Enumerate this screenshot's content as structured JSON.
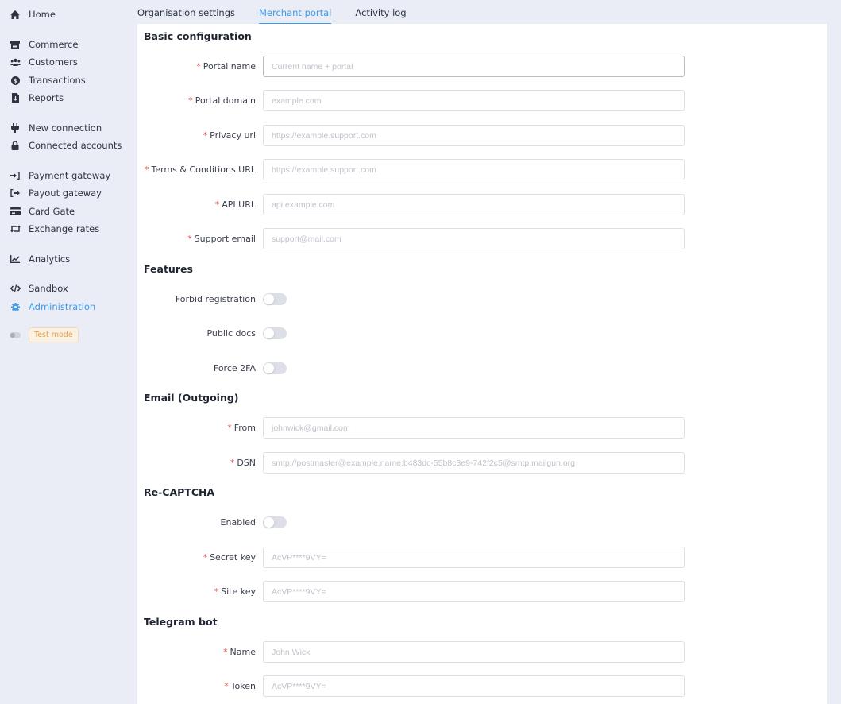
{
  "sidebar": {
    "items": [
      {
        "label": "Home",
        "icon": "home-icon"
      },
      {
        "label": "Commerce",
        "icon": "store-icon"
      },
      {
        "label": "Customers",
        "icon": "users-icon"
      },
      {
        "label": "Transactions",
        "icon": "dollar-circle-icon"
      },
      {
        "label": "Reports",
        "icon": "file-download-icon"
      },
      {
        "label": "New connection",
        "icon": "plug-icon"
      },
      {
        "label": "Connected accounts",
        "icon": "lock-icon"
      },
      {
        "label": "Payment gateway",
        "icon": "sign-in-icon"
      },
      {
        "label": "Payout gateway",
        "icon": "sign-out-icon"
      },
      {
        "label": "Card Gate",
        "icon": "credit-card-icon"
      },
      {
        "label": "Exchange rates",
        "icon": "retweet-icon"
      },
      {
        "label": "Analytics",
        "icon": "chart-line-icon"
      },
      {
        "label": "Sandbox",
        "icon": "code-icon"
      },
      {
        "label": "Administration",
        "icon": "gear-icon",
        "active": true
      }
    ],
    "test_mode_label": "Test mode"
  },
  "tabs": [
    {
      "label": "Organisation settings"
    },
    {
      "label": "Merchant portal",
      "active": true
    },
    {
      "label": "Activity log"
    }
  ],
  "sections": {
    "basic": {
      "title": "Basic configuration",
      "fields": [
        {
          "label": "Portal name",
          "placeholder": "Current name + portal",
          "required": true
        },
        {
          "label": "Portal domain",
          "placeholder": "example.com",
          "required": true
        },
        {
          "label": "Privacy url",
          "placeholder": "https://example.support.com",
          "required": true
        },
        {
          "label": "Terms & Conditions URL",
          "placeholder": "https://example.support.com",
          "required": true
        },
        {
          "label": "API URL",
          "placeholder": "api.example.com",
          "required": true
        },
        {
          "label": "Support email",
          "placeholder": "support@mail.com",
          "required": true
        }
      ]
    },
    "features": {
      "title": "Features",
      "toggles": [
        {
          "label": "Forbid registration",
          "on": false
        },
        {
          "label": "Public docs",
          "on": false
        },
        {
          "label": "Force 2FA",
          "on": false
        }
      ]
    },
    "email": {
      "title": "Email (Outgoing)",
      "fields": [
        {
          "label": "From",
          "placeholder": "johnwick@gmail.com",
          "required": true
        },
        {
          "label": "DSN",
          "placeholder": "smtp://postmaster@example.name:b483dc-55b8c3e9-742f2c5@smtp.mailgun.org",
          "required": true
        }
      ]
    },
    "recaptcha": {
      "title": "Re-CAPTCHA",
      "toggle": {
        "label": "Enabled",
        "on": false
      },
      "fields": [
        {
          "label": "Secret key",
          "placeholder": "AcVP****9VY=",
          "required": true
        },
        {
          "label": "Site key",
          "placeholder": "AcVP****9VY=",
          "required": true
        }
      ]
    },
    "telegram": {
      "title": "Telegram bot",
      "fields": [
        {
          "label": "Name",
          "placeholder": "John Wick",
          "required": true
        },
        {
          "label": "Token",
          "placeholder": "AcVP****9VY=",
          "required": true
        }
      ]
    }
  },
  "required_marker": "*",
  "colors": {
    "accent": "#3d9be9",
    "required": "#e45a5a",
    "test_mode": "#e8a04a",
    "background": "#eaedf6"
  }
}
